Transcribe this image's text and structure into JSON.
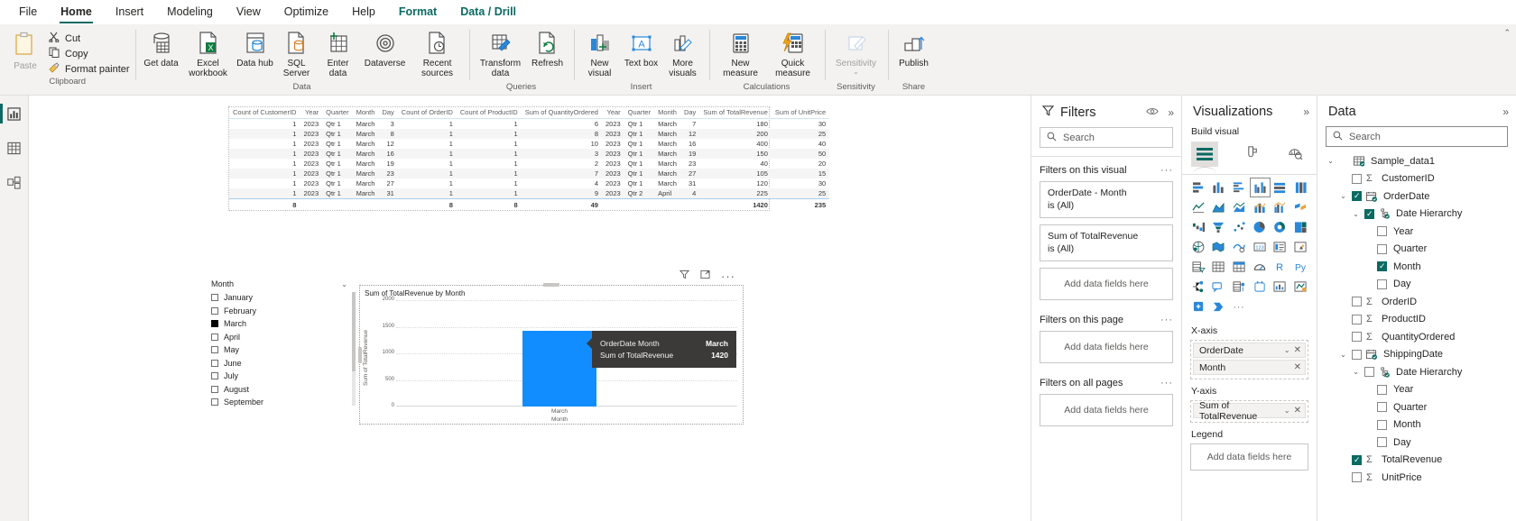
{
  "ribbon": {
    "tabs": [
      {
        "label": "File",
        "state": "normal"
      },
      {
        "label": "Home",
        "state": "active"
      },
      {
        "label": "Insert",
        "state": "normal"
      },
      {
        "label": "Modeling",
        "state": "normal"
      },
      {
        "label": "View",
        "state": "normal"
      },
      {
        "label": "Optimize",
        "state": "normal"
      },
      {
        "label": "Help",
        "state": "normal"
      },
      {
        "label": "Format",
        "state": "contextual"
      },
      {
        "label": "Data / Drill",
        "state": "contextual-selected"
      }
    ],
    "clipboard": {
      "group_label": "Clipboard",
      "paste_label": "Paste",
      "cut_label": "Cut",
      "copy_label": "Copy",
      "format_painter_label": "Format painter"
    },
    "groups": [
      {
        "label": "Data",
        "buttons": [
          {
            "label": "Get data",
            "icon": "get-data-icon",
            "caret": true
          },
          {
            "label": "Excel workbook",
            "icon": "excel-workbook-icon",
            "caret": false
          },
          {
            "label": "Data hub",
            "icon": "data-hub-icon",
            "caret": true
          },
          {
            "label": "SQL Server",
            "icon": "sql-server-icon",
            "caret": false
          },
          {
            "label": "Enter data",
            "icon": "enter-data-icon",
            "caret": false
          },
          {
            "label": "Dataverse",
            "icon": "dataverse-icon",
            "caret": false
          },
          {
            "label": "Recent sources",
            "icon": "recent-sources-icon",
            "caret": true
          }
        ]
      },
      {
        "label": "Queries",
        "buttons": [
          {
            "label": "Transform data",
            "icon": "transform-data-icon",
            "caret": true
          },
          {
            "label": "Refresh",
            "icon": "refresh-icon",
            "caret": false
          }
        ]
      },
      {
        "label": "Insert",
        "buttons": [
          {
            "label": "New visual",
            "icon": "new-visual-icon",
            "caret": false
          },
          {
            "label": "Text box",
            "icon": "text-box-icon",
            "caret": false
          },
          {
            "label": "More visuals",
            "icon": "more-visuals-icon",
            "caret": true
          }
        ]
      },
      {
        "label": "Calculations",
        "buttons": [
          {
            "label": "New measure",
            "icon": "new-measure-icon",
            "caret": false
          },
          {
            "label": "Quick measure",
            "icon": "quick-measure-icon",
            "caret": false
          }
        ]
      },
      {
        "label": "Sensitivity",
        "buttons": [
          {
            "label": "Sensitivity",
            "icon": "sensitivity-icon",
            "caret": true,
            "disabled": true
          }
        ]
      },
      {
        "label": "Share",
        "buttons": [
          {
            "label": "Publish",
            "icon": "publish-icon",
            "caret": false
          }
        ]
      }
    ]
  },
  "leftbar": {
    "items": [
      {
        "name": "report-view",
        "icon": "report-chart-icon",
        "active": true
      },
      {
        "name": "table-view",
        "icon": "table-grid-icon",
        "active": false
      },
      {
        "name": "model-view",
        "icon": "model-relationship-icon",
        "active": false
      }
    ]
  },
  "table_visual": {
    "columns": [
      "Count of CustomerID",
      "Year",
      "Quarter",
      "Month",
      "Day",
      "Count of OrderID",
      "Count of ProductID",
      "Sum of QuantityOrdered",
      "Year",
      "Quarter",
      "Month",
      "Day",
      "Sum of TotalRevenue",
      "Sum of UnitPrice"
    ],
    "rows": [
      [
        "1",
        "2023",
        "Qtr 1",
        "March",
        "3",
        "1",
        "1",
        "6",
        "2023",
        "Qtr 1",
        "March",
        "7",
        "180",
        "30"
      ],
      [
        "1",
        "2023",
        "Qtr 1",
        "March",
        "8",
        "1",
        "1",
        "8",
        "2023",
        "Qtr 1",
        "March",
        "12",
        "200",
        "25"
      ],
      [
        "1",
        "2023",
        "Qtr 1",
        "March",
        "12",
        "1",
        "1",
        "10",
        "2023",
        "Qtr 1",
        "March",
        "16",
        "400",
        "40"
      ],
      [
        "1",
        "2023",
        "Qtr 1",
        "March",
        "16",
        "1",
        "1",
        "3",
        "2023",
        "Qtr 1",
        "March",
        "19",
        "150",
        "50"
      ],
      [
        "1",
        "2023",
        "Qtr 1",
        "March",
        "19",
        "1",
        "1",
        "2",
        "2023",
        "Qtr 1",
        "March",
        "23",
        "40",
        "20"
      ],
      [
        "1",
        "2023",
        "Qtr 1",
        "March",
        "23",
        "1",
        "1",
        "7",
        "2023",
        "Qtr 1",
        "March",
        "27",
        "105",
        "15"
      ],
      [
        "1",
        "2023",
        "Qtr 1",
        "March",
        "27",
        "1",
        "1",
        "4",
        "2023",
        "Qtr 1",
        "March",
        "31",
        "120",
        "30"
      ],
      [
        "1",
        "2023",
        "Qtr 1",
        "March",
        "31",
        "1",
        "1",
        "9",
        "2023",
        "Qtr 2",
        "April",
        "4",
        "225",
        "25"
      ]
    ],
    "totals": [
      "8",
      "",
      "",
      "",
      "",
      "8",
      "8",
      "49",
      "",
      "",
      "",
      "",
      "1420",
      "235"
    ]
  },
  "slicer": {
    "title": "Month",
    "items": [
      {
        "label": "January",
        "checked": false
      },
      {
        "label": "February",
        "checked": false
      },
      {
        "label": "March",
        "checked": true
      },
      {
        "label": "April",
        "checked": false
      },
      {
        "label": "May",
        "checked": false
      },
      {
        "label": "June",
        "checked": false
      },
      {
        "label": "July",
        "checked": false
      },
      {
        "label": "August",
        "checked": false
      },
      {
        "label": "September",
        "checked": false
      }
    ]
  },
  "chart_data": {
    "type": "bar",
    "title": "Sum of TotalRevenue by Month",
    "categories": [
      "March"
    ],
    "values": [
      1420
    ],
    "xlabel": "Month",
    "ylabel": "Sum of TotalRevenue",
    "ylim": [
      0,
      2000
    ],
    "yticks": [
      0,
      500,
      1000,
      1500,
      2000
    ],
    "ytick_labels": [
      "0",
      "500",
      "1000",
      "1500",
      "2000"
    ],
    "grid": true,
    "legend": null,
    "bar_color": "#118dff",
    "annotations": {
      "tooltip": {
        "rows": [
          {
            "key": "OrderDate Month",
            "value": "March"
          },
          {
            "key": "Sum of TotalRevenue",
            "value": "1420"
          }
        ]
      }
    }
  },
  "filters_pane": {
    "title": "Filters",
    "search_placeholder": "Search",
    "sections": [
      {
        "heading": "Filters on this visual",
        "cards": [
          {
            "field": "OrderDate - Month",
            "state": "is (All)"
          },
          {
            "field": "Sum of TotalRevenue",
            "state": "is (All)"
          }
        ],
        "drop_label": "Add data fields here"
      },
      {
        "heading": "Filters on this page",
        "cards": [],
        "drop_label": "Add data fields here"
      },
      {
        "heading": "Filters on all pages",
        "cards": [],
        "drop_label": "Add data fields here"
      }
    ]
  },
  "visualizations_pane": {
    "title": "Visualizations",
    "build_label": "Build visual",
    "selected_visual_icon": "clustered-column-chart-icon",
    "tab_icons": [
      "build-visual-icon",
      "format-visual-icon",
      "analytics-icon"
    ],
    "gallery": [
      "stacked-bar-chart-icon",
      "stacked-column-chart-icon",
      "clustered-bar-chart-icon",
      "clustered-column-chart-icon",
      "hundred-stacked-bar-icon",
      "hundred-stacked-column-icon",
      "line-chart-icon",
      "area-chart-icon",
      "stacked-area-chart-icon",
      "line-stacked-column-icon",
      "line-clustered-column-icon",
      "ribbon-chart-icon",
      "waterfall-chart-icon",
      "funnel-chart-icon",
      "scatter-chart-icon",
      "pie-chart-icon",
      "donut-chart-icon",
      "treemap-icon",
      "map-icon",
      "filled-map-icon",
      "azure-map-icon",
      "card-icon",
      "multi-row-card-icon",
      "kpi-icon",
      "slicer-icon",
      "table-icon",
      "matrix-icon",
      "gauge-icon",
      "r-script-visual-icon",
      "python-visual-icon",
      "decomposition-tree-icon",
      "key-influencers-icon",
      "qa-visual-icon",
      "paginated-report-icon",
      "smart-narrative-icon",
      "metrics-icon",
      "power-apps-icon",
      "power-automate-icon",
      "more-options-icon"
    ],
    "wells": [
      {
        "label": "X-axis",
        "chips": [
          {
            "label": "OrderDate",
            "has_caret": true,
            "has_close": true
          },
          {
            "label": "Month",
            "has_caret": false,
            "has_close": true
          }
        ],
        "drop_label": null
      },
      {
        "label": "Y-axis",
        "chips": [
          {
            "label": "Sum of TotalRevenue",
            "has_caret": true,
            "has_close": true
          }
        ],
        "drop_label": null
      },
      {
        "label": "Legend",
        "chips": [],
        "drop_label": "Add data fields here"
      }
    ]
  },
  "data_pane": {
    "title": "Data",
    "search_placeholder": "Search",
    "tree": [
      {
        "label": "Sample_data1",
        "depth": 0,
        "chevron": "down",
        "checkbox": "none",
        "icon": "table-icon"
      },
      {
        "label": "CustomerID",
        "depth": 1,
        "chevron": "none",
        "checkbox": "off",
        "icon": "sigma-icon"
      },
      {
        "label": "OrderDate",
        "depth": 1,
        "chevron": "down",
        "checkbox": "on",
        "icon": "calendar-icon"
      },
      {
        "label": "Date Hierarchy",
        "depth": 2,
        "chevron": "down",
        "checkbox": "on",
        "icon": "hierarchy-icon"
      },
      {
        "label": "Year",
        "depth": 3,
        "chevron": "none",
        "checkbox": "off",
        "icon": "none"
      },
      {
        "label": "Quarter",
        "depth": 3,
        "chevron": "none",
        "checkbox": "off",
        "icon": "none"
      },
      {
        "label": "Month",
        "depth": 3,
        "chevron": "none",
        "checkbox": "on",
        "icon": "none"
      },
      {
        "label": "Day",
        "depth": 3,
        "chevron": "none",
        "checkbox": "off",
        "icon": "none"
      },
      {
        "label": "OrderID",
        "depth": 1,
        "chevron": "none",
        "checkbox": "off",
        "icon": "sigma-icon"
      },
      {
        "label": "ProductID",
        "depth": 1,
        "chevron": "none",
        "checkbox": "off",
        "icon": "sigma-icon"
      },
      {
        "label": "QuantityOrdered",
        "depth": 1,
        "chevron": "none",
        "checkbox": "off",
        "icon": "sigma-icon"
      },
      {
        "label": "ShippingDate",
        "depth": 1,
        "chevron": "down",
        "checkbox": "off",
        "icon": "calendar-icon"
      },
      {
        "label": "Date Hierarchy",
        "depth": 2,
        "chevron": "down",
        "checkbox": "off",
        "icon": "hierarchy-icon"
      },
      {
        "label": "Year",
        "depth": 3,
        "chevron": "none",
        "checkbox": "off",
        "icon": "none"
      },
      {
        "label": "Quarter",
        "depth": 3,
        "chevron": "none",
        "checkbox": "off",
        "icon": "none"
      },
      {
        "label": "Month",
        "depth": 3,
        "chevron": "none",
        "checkbox": "off",
        "icon": "none"
      },
      {
        "label": "Day",
        "depth": 3,
        "chevron": "none",
        "checkbox": "off",
        "icon": "none"
      },
      {
        "label": "TotalRevenue",
        "depth": 1,
        "chevron": "none",
        "checkbox": "on",
        "icon": "sigma-icon"
      },
      {
        "label": "UnitPrice",
        "depth": 1,
        "chevron": "none",
        "checkbox": "off",
        "icon": "sigma-icon"
      }
    ]
  },
  "colors": {
    "accent": "#0b6a62",
    "bar": "#118dff",
    "ribbon_bg": "#f3f2f1",
    "tooltip_bg": "#3b3a39"
  }
}
